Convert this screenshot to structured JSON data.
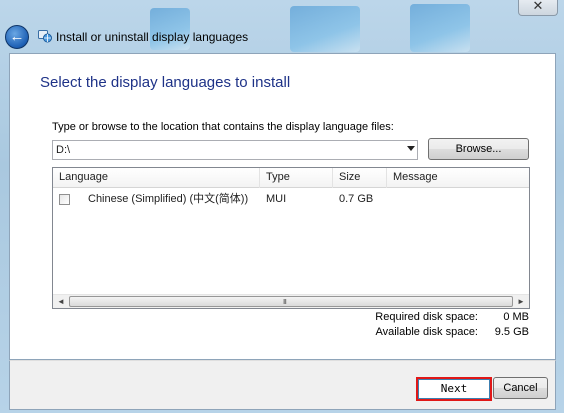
{
  "window": {
    "title": "Install or uninstall display languages",
    "close_glyph": "✕",
    "back_glyph": "←"
  },
  "main": {
    "heading": "Select the display languages to install",
    "instruction": "Type or browse to the location that contains the display language files:",
    "location_value": "D:\\",
    "browse_label": "Browse..."
  },
  "list": {
    "columns": [
      "Language",
      "Type",
      "Size",
      "Message"
    ],
    "rows": [
      {
        "checked": false,
        "language": "Chinese (Simplified) (中文(简体))",
        "type": "MUI",
        "size": "0.7 GB",
        "message": ""
      }
    ],
    "scroll_left": "◄",
    "scroll_right": "►",
    "grip": "III"
  },
  "disk": {
    "required_label": "Required disk space:",
    "required_value": "0 MB",
    "available_label": "Available disk space:",
    "available_value": "9.5 GB"
  },
  "buttons": {
    "next_label": "Next",
    "cancel_label": "Cancel"
  },
  "colors": {
    "heading": "#1e3287",
    "highlight": "#e01818"
  }
}
